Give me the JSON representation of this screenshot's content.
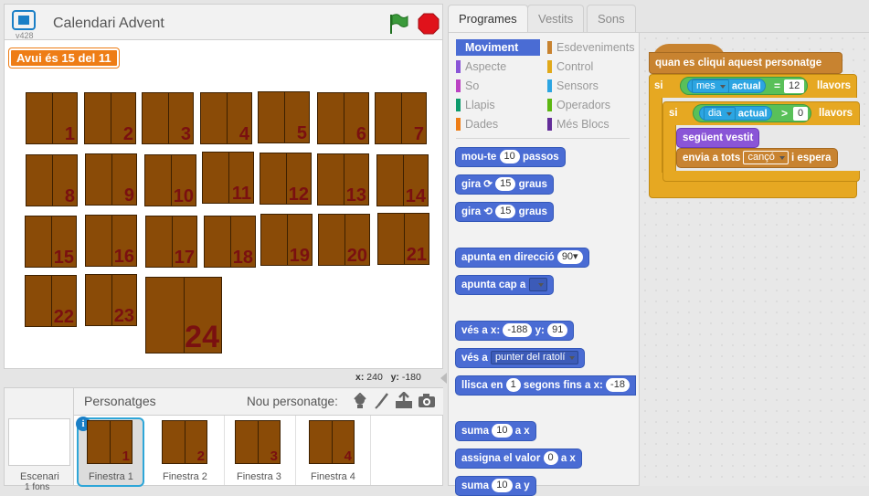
{
  "stage": {
    "title": "Calendari Advent",
    "version": "v428",
    "banner": "Avui és 15 del 11",
    "coords": {
      "x_label": "x:",
      "x_value": "240",
      "y_label": "y:",
      "y_value": "-180"
    }
  },
  "doors": [
    "1",
    "2",
    "3",
    "4",
    "5",
    "6",
    "7",
    "8",
    "9",
    "10",
    "11",
    "12",
    "13",
    "14",
    "15",
    "16",
    "17",
    "18",
    "19",
    "20",
    "21",
    "22",
    "23",
    "24"
  ],
  "sprites_pane": {
    "title": "Personatges",
    "new_sprite_label": "Nou personatge:",
    "stage_thumb_label": "Escenari",
    "stage_thumb_sub": "1 fons",
    "sprites": [
      {
        "name": "Finestra 1",
        "number": "1",
        "selected": true
      },
      {
        "name": "Finestra 2",
        "number": "2",
        "selected": false
      },
      {
        "name": "Finestra 3",
        "number": "3",
        "selected": false
      },
      {
        "name": "Finestra 4",
        "number": "4",
        "selected": false
      }
    ]
  },
  "tabs": [
    "Programes",
    "Vestits",
    "Sons"
  ],
  "categories": [
    {
      "label": "Moviment",
      "color": "#4a6cd4",
      "active": true
    },
    {
      "label": "Esdeveniments",
      "color": "#c88330"
    },
    {
      "label": "Aspecte",
      "color": "#8a55d7"
    },
    {
      "label": "Control",
      "color": "#e1a91a"
    },
    {
      "label": "So",
      "color": "#bb42c3"
    },
    {
      "label": "Sensors",
      "color": "#2ca5e2"
    },
    {
      "label": "Llapis",
      "color": "#0e9a6c"
    },
    {
      "label": "Operadors",
      "color": "#5cb712"
    },
    {
      "label": "Dades",
      "color": "#ee7d16"
    },
    {
      "label": "Més Blocs",
      "color": "#632d99"
    }
  ],
  "palette": {
    "move_pre": "mou-te",
    "move_val": "10",
    "move_post": "passos",
    "turn_right_pre": "gira",
    "turn_right_val": "15",
    "turn_right_post": "graus",
    "turn_left_pre": "gira",
    "turn_left_val": "15",
    "turn_left_post": "graus",
    "point_dir_pre": "apunta en direcció",
    "point_dir_val": "90▾",
    "point_towards": "apunta cap a",
    "goto_xy_pre": "vés a x:",
    "goto_x": "-188",
    "goto_y_label": "y:",
    "goto_y": "91",
    "goto_pre": "vés a",
    "goto_target": "punter del ratolí",
    "glide_pre": "llisca en",
    "glide_val": "1",
    "glide_mid": "segons fins a x:",
    "glide_x": "-18",
    "change_pre": "suma",
    "change_val": "10",
    "change_post": "a x",
    "set_pre": "assigna el valor",
    "set_val": "0",
    "set_post": "a x",
    "change2_pre": "suma",
    "change2_val": "10",
    "change2_post": "a y"
  },
  "script": {
    "hat": "quan es cliqui aquest personatge",
    "if1_pre": "si",
    "if1_dd": "mes",
    "if1_var": "actual",
    "if1_op": "=",
    "if1_val": "12",
    "if1_post": "llavors",
    "if2_pre": "si",
    "if2_dd": "dia",
    "if2_var": "actual",
    "if2_op": ">",
    "if2_val": "0",
    "if2_post": "llavors",
    "next_costume": "següent vestit",
    "broadcast_pre": "envia a tots",
    "broadcast_val": "cançó",
    "broadcast_post": "i espera"
  }
}
